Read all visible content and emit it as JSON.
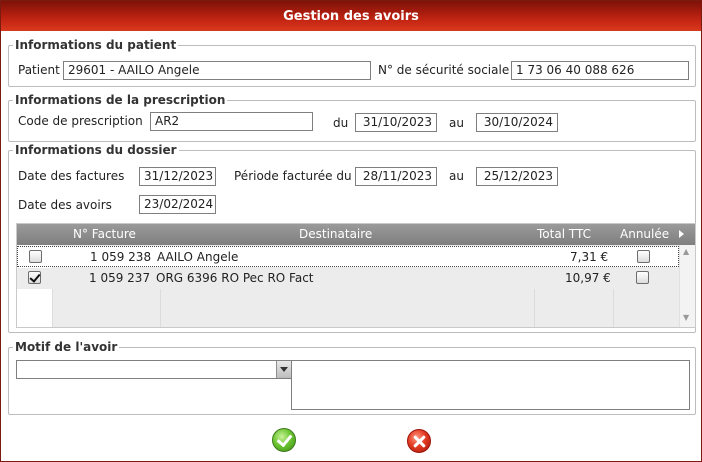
{
  "dialog": {
    "title": "Gestion des avoirs"
  },
  "patient": {
    "legend": "Informations du patient",
    "patient_label": "Patient",
    "patient_value": "29601 - AAILO Angele",
    "secu_label": "N° de sécurité sociale",
    "secu_value": "1 73 06 40 088 626"
  },
  "prescription": {
    "legend": "Informations de la prescription",
    "code_label": "Code de prescription",
    "code_value": "AR2",
    "du_label": "du",
    "du_value": "31/10/2023",
    "au_label": "au",
    "au_value": "30/10/2024"
  },
  "dossier": {
    "legend": "Informations du dossier",
    "date_factures_label": "Date des factures",
    "date_factures_value": "31/12/2023",
    "periode_label": "Période facturée du",
    "periode_du_value": "28/11/2023",
    "au_label": "au",
    "periode_au_value": "25/12/2023",
    "date_avoirs_label": "Date des avoirs",
    "date_avoirs_value": "23/02/2024",
    "grid": {
      "columns": [
        "N° Facture",
        "Destinataire",
        "Total TTC",
        "Annulée"
      ],
      "more_columns_icon": "triangle-right-icon",
      "rows": [
        {
          "selected": false,
          "numero": "1 059 238",
          "destinataire": "AAILO Angele",
          "total": "7,31 €",
          "annulee": false
        },
        {
          "selected": true,
          "numero": "1 059 237",
          "destinataire": "ORG 6396 RO Pec RO Fact",
          "total": "10,97 €",
          "annulee": false
        }
      ]
    }
  },
  "motif": {
    "legend": "Motif de l'avoir",
    "select_value": "",
    "comment_value": ""
  },
  "actions": {
    "ok_icon": "green-check-icon",
    "cancel_icon": "red-x-icon"
  }
}
